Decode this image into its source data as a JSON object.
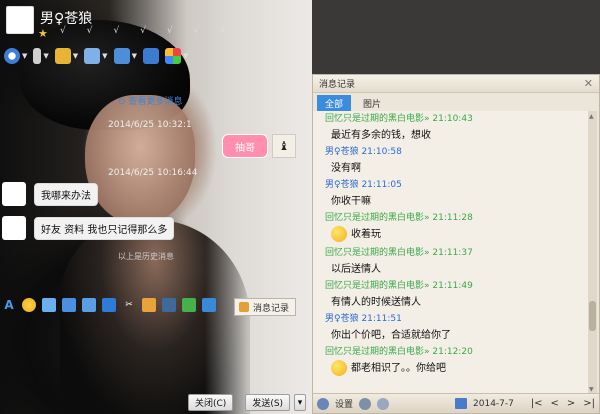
{
  "chat": {
    "contact_name": "男♀苍狼",
    "load_more": "查看更多消息",
    "timestamp1": "2014/6/25 10:32:1",
    "timestamp2": "2014/6/25 10:16:44",
    "sticker_text": "抽哥",
    "messages": [
      "我哪来办法",
      "好友 资料 我也只记得那么多"
    ],
    "above_note": "以上是历史消息",
    "history_btn": "消息记录",
    "close_btn": "关闭(C)",
    "send_btn": "发送(S)"
  },
  "history": {
    "title": "消息记录",
    "tabs": [
      "全部",
      "图片"
    ],
    "entries": [
      {
        "head": "回忆只是过期的黑白电影» 21:10:43",
        "color": "green",
        "text": "最近有多余的钱，想收"
      },
      {
        "head": "男♀苍狼 21:10:58",
        "color": "blue",
        "text": "没有啊"
      },
      {
        "head": "男♀苍狼 21:11:05",
        "color": "blue",
        "text": "你收干嘛"
      },
      {
        "head": "回忆只是过期的黑白电影» 21:11:28",
        "color": "green",
        "text": "收着玩",
        "emoji": true
      },
      {
        "head": "回忆只是过期的黑白电影» 21:11:37",
        "color": "green",
        "text": "以后送情人"
      },
      {
        "head": "回忆只是过期的黑白电影» 21:11:49",
        "color": "green",
        "text": "有情人的时候送情人"
      },
      {
        "head": "男♀苍狼 21:11:51",
        "color": "blue",
        "text": "你出个价吧，合适就给你了"
      },
      {
        "head": "回忆只是过期的黑白电影» 21:12:20",
        "color": "green",
        "text": "都老相识了。。你给吧",
        "emoji": true
      }
    ],
    "footer": {
      "settings": "设置",
      "date": "2014-7-7"
    }
  }
}
